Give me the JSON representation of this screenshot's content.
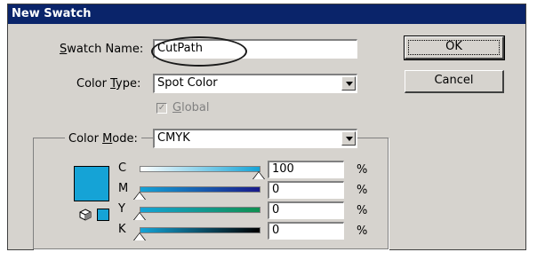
{
  "window": {
    "title": "New Swatch"
  },
  "swatch_name": {
    "label_pre": "",
    "label_ul": "S",
    "label_post": "watch Name:",
    "value": "CutPath"
  },
  "color_type": {
    "label_pre": "Color ",
    "label_ul": "T",
    "label_post": "ype:",
    "value": "Spot Color"
  },
  "global": {
    "label_ul": "G",
    "label_post": "lobal",
    "checked": true
  },
  "color_mode": {
    "label_pre": "Color ",
    "label_ul": "M",
    "label_post": "ode:",
    "value": "CMYK"
  },
  "buttons": {
    "ok": "OK",
    "cancel": "Cancel"
  },
  "channels": [
    {
      "letter": "C",
      "value": "100",
      "unit": "%",
      "fraction": 1.0,
      "gradient": [
        "#ffffff",
        "#15a3d6"
      ]
    },
    {
      "letter": "M",
      "value": "0",
      "unit": "%",
      "fraction": 0.0,
      "gradient": [
        "#15a3d6",
        "#1a1a8a"
      ]
    },
    {
      "letter": "Y",
      "value": "0",
      "unit": "%",
      "fraction": 0.0,
      "gradient": [
        "#15a3d6",
        "#109050"
      ]
    },
    {
      "letter": "K",
      "value": "0",
      "unit": "%",
      "fraction": 0.0,
      "gradient": [
        "#15a3d6",
        "#000000"
      ]
    }
  ],
  "colors": {
    "swatch": "#15a3d6",
    "titlebar": "#0a246a",
    "dialog_bg": "#d6d3ce"
  },
  "icons": {
    "gamut": "cube-icon"
  }
}
